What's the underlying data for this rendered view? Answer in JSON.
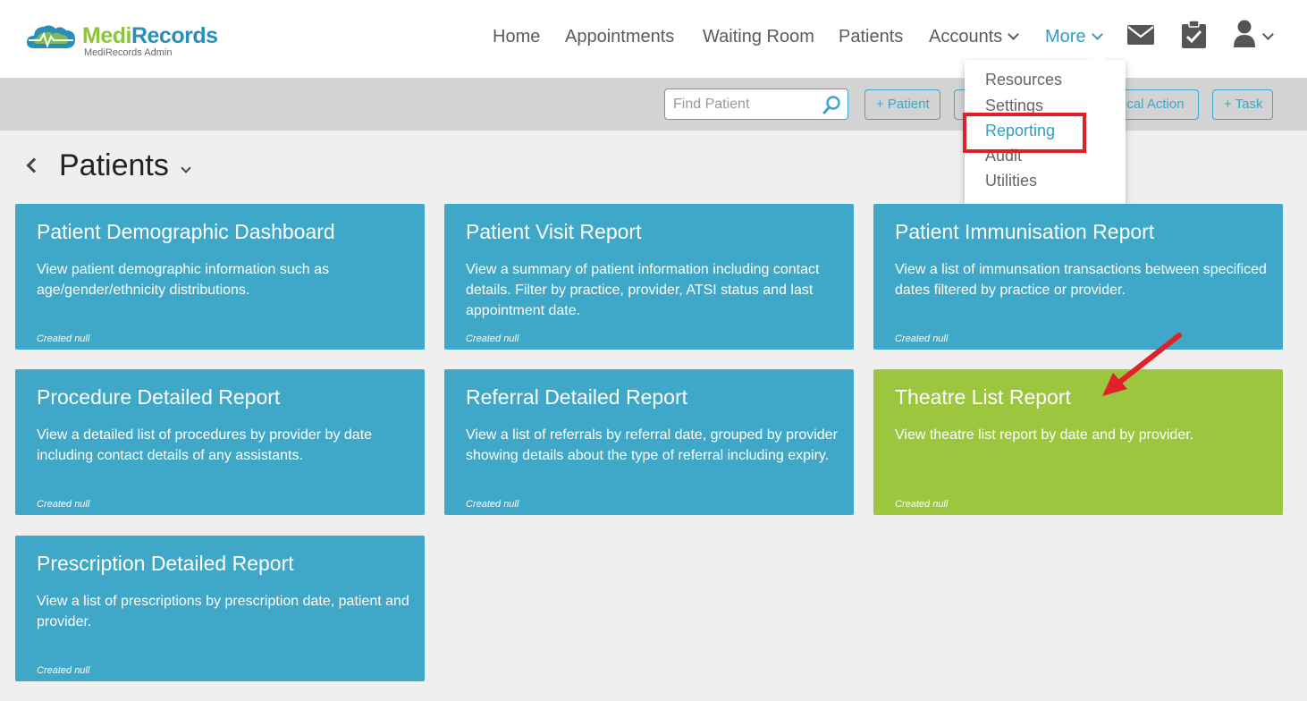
{
  "brand": {
    "name_part1": "Medi",
    "name_part2": "Records",
    "subtitle": "MediRecords Admin",
    "colors": {
      "green": "#8cc43e",
      "blue": "#2a8fb8"
    }
  },
  "nav": {
    "home": "Home",
    "appointments": "Appointments",
    "waiting_room": "Waiting Room",
    "patients": "Patients",
    "accounts": "Accounts",
    "more": "More",
    "icons": [
      "mail-icon",
      "clipboard-check-icon",
      "user-icon"
    ]
  },
  "toolbar": {
    "search_placeholder": "Find Patient",
    "buttons": [
      "+ Patient",
      "",
      "ical Action",
      "+ Task"
    ]
  },
  "more_menu": {
    "items": [
      "Resources",
      "Settings",
      "Reporting",
      "Audit",
      "Utilities"
    ],
    "highlighted": "Reporting"
  },
  "page": {
    "title": "Patients"
  },
  "reports": [
    {
      "title": "Patient Demographic Dashboard",
      "description": "View patient demographic information such as age/gender/ethnicity distributions.",
      "meta": "Created null"
    },
    {
      "title": "Patient Visit Report",
      "description": "View a summary of patient information including contact details. Filter by practice, provider, ATSI status and last appointment date.",
      "meta": "Created null"
    },
    {
      "title": "Patient Immunisation Report",
      "description": "View a list of immunsation transactions between specificed dates filtered by practice or provider.",
      "meta": "Created null"
    },
    {
      "title": "Procedure Detailed Report",
      "description": "View a detailed list of procedures by provider by date including contact details of any assistants.",
      "meta": "Created null"
    },
    {
      "title": "Referral Detailed Report",
      "description": "View a list of referrals by referral date, grouped by provider showing details about the type of referral including expiry.",
      "meta": "Created null"
    },
    {
      "title": "Theatre List Report",
      "description": "View theatre list report by date and by provider.",
      "meta": "Created null"
    },
    {
      "title": "Prescription Detailed Report",
      "description": "View a list of prescriptions by prescription date, patient and provider.",
      "meta": "Created null"
    }
  ],
  "colors": {
    "card_blue": "#3fa8c8",
    "card_green": "#9cc63e",
    "accent": "#2f9ec7",
    "annotation_red": "#e0212a"
  }
}
